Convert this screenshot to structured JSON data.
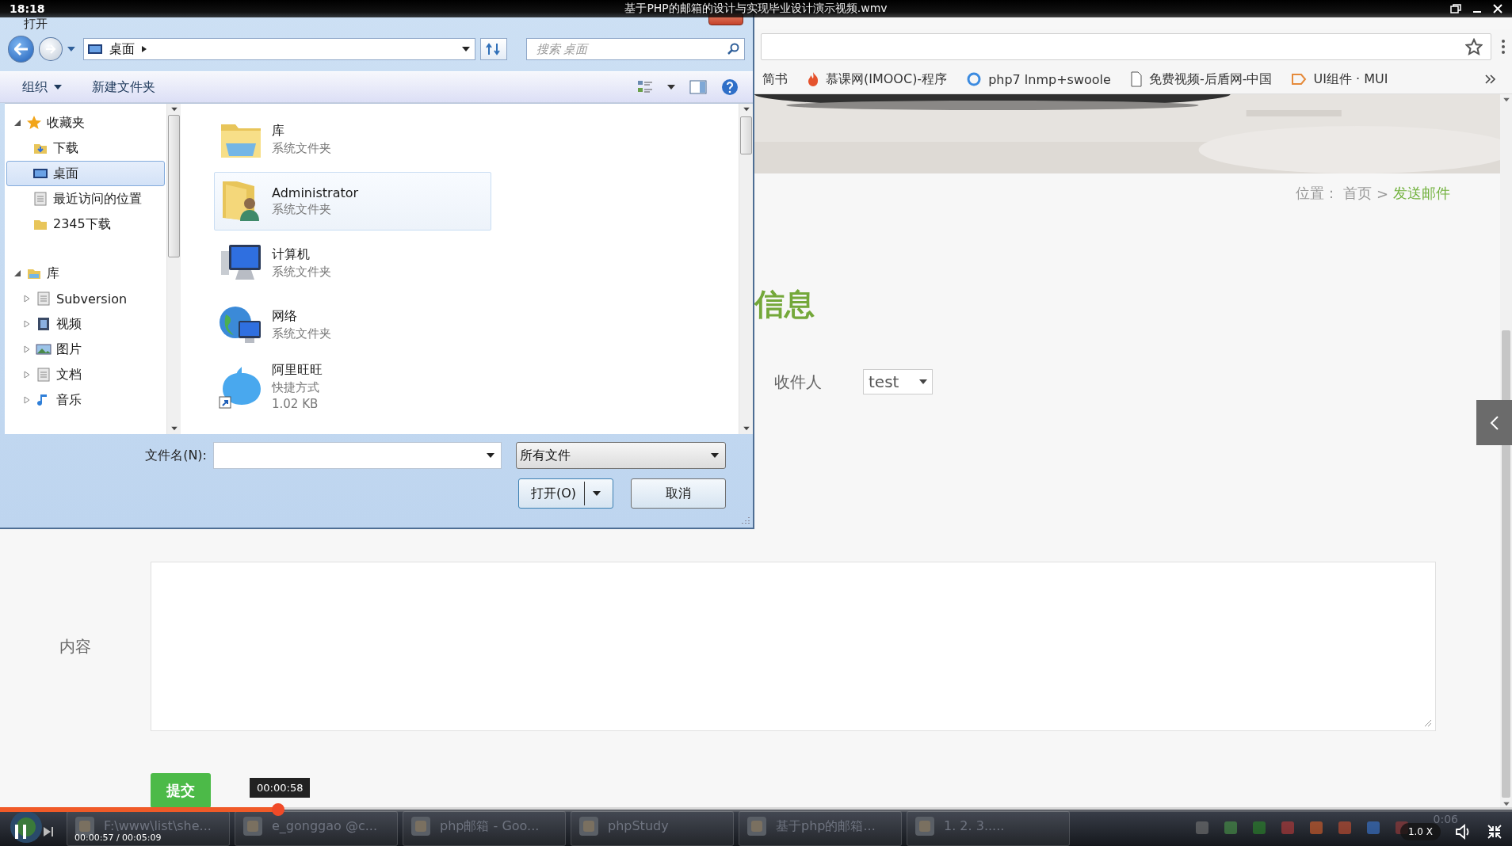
{
  "player": {
    "clock": "18:18",
    "title": "基于PHP的邮箱的设计与实现毕业设计演示视频.wmv",
    "progress": {
      "level": 0.184
    },
    "tooltip": "00:00:58",
    "time": "00:00:57 / 00:05:09",
    "speed": "1.0 X"
  },
  "dialog": {
    "title": "打开",
    "path": "桌面",
    "search_placeholder": "搜索 桌面",
    "toolbar": [
      "组织",
      "新建文件夹"
    ],
    "nav": [
      {
        "label": "收藏夹",
        "expanded": true,
        "children": [
          {
            "label": "下载",
            "selected": false
          },
          {
            "label": "桌面",
            "selected": true
          },
          {
            "label": "最近访问的位置",
            "selected": false
          },
          {
            "label": "2345下载",
            "selected": false
          }
        ]
      },
      {
        "label": "库",
        "expanded": true,
        "children": [
          {
            "label": "Subversion",
            "selected": false,
            "expanded": false
          },
          {
            "label": "视频",
            "selected": false,
            "expanded": false
          },
          {
            "label": "图片",
            "selected": false,
            "expanded": false
          },
          {
            "label": "文档",
            "selected": false,
            "expanded": false
          },
          {
            "label": "音乐",
            "selected": false,
            "expanded": false
          }
        ]
      }
    ],
    "files": [
      {
        "name": "库",
        "type": "系统文件夹",
        "selected": false
      },
      {
        "name": "Administrator",
        "type": "系统文件夹",
        "selected": true
      },
      {
        "name": "计算机",
        "type": "系统文件夹",
        "selected": false
      },
      {
        "name": "网络",
        "type": "系统文件夹",
        "selected": false
      },
      {
        "name": "阿里旺旺",
        "type": "快捷方式",
        "size": "1.02 KB",
        "selected": false
      }
    ],
    "filename_label": "文件名(N):",
    "filter": "所有文件",
    "buttons": [
      "打开(O)",
      "取消"
    ]
  },
  "browser": {
    "bookmarks": [
      "简书",
      "慕课网(IMOOC)-程序",
      "php7 lnmp+swoole",
      "免费视频-后盾网-中国",
      "UI组件 · MUI"
    ],
    "breadcrumb": {
      "label": "位置：",
      "home": "首页",
      "separator": ">",
      "current": "发送邮件"
    },
    "heading": "信息",
    "recipient_label": "收件人",
    "recipient_value": "test",
    "content_label": "内容",
    "submit": "提交"
  },
  "taskbar": {
    "items": [
      "F:\\www\\list\\she...",
      "e_gonggao @c...",
      "php邮箱 - Goo...",
      "phpStudy",
      "基于php的邮箱...",
      "1. 2. 3....."
    ],
    "clock": "0:06"
  }
}
